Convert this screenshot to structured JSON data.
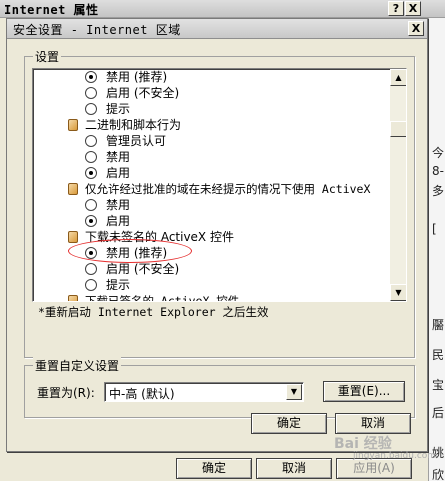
{
  "outer_window": {
    "title": "Internet 属性",
    "help_button": "?",
    "close_button": "X",
    "buttons": {
      "ok": "确定",
      "cancel": "取消",
      "apply": "应用(A)"
    },
    "background_fragments": [
      "今",
      "8-",
      "多",
      "[",
      "靨",
      "民",
      "宝",
      "后",
      "姚",
      "欣"
    ]
  },
  "dialog": {
    "title": "安全设置 - Internet 区域",
    "close_button": "X",
    "settings_group_label": "设置",
    "settings_items": [
      {
        "kind": "option",
        "label": "禁用 (推荐)",
        "checked": true
      },
      {
        "kind": "option",
        "label": "启用 (不安全)",
        "checked": false
      },
      {
        "kind": "option",
        "label": "提示",
        "checked": false
      },
      {
        "kind": "category",
        "label": "二进制和脚本行为"
      },
      {
        "kind": "option",
        "label": "管理员认可",
        "checked": false
      },
      {
        "kind": "option",
        "label": "禁用",
        "checked": false
      },
      {
        "kind": "option",
        "label": "启用",
        "checked": true
      },
      {
        "kind": "category",
        "label": "仅允许经过批准的域在未经提示的情况下使用 ActiveX"
      },
      {
        "kind": "option",
        "label": "禁用",
        "checked": false
      },
      {
        "kind": "option",
        "label": "启用",
        "checked": true
      },
      {
        "kind": "category",
        "label": "下载未签名的 ActiveX 控件"
      },
      {
        "kind": "option",
        "label": "禁用 (推荐)",
        "checked": true
      },
      {
        "kind": "option",
        "label": "启用 (不安全)",
        "checked": false
      },
      {
        "kind": "option",
        "label": "提示",
        "checked": false
      },
      {
        "kind": "category",
        "label": "下载已签名的 ActiveX 控件"
      }
    ],
    "restart_note": "*重新启动 Internet Explorer 之后生效",
    "reset_group_label": "重置自定义设置",
    "reset_to_label": "重置为(R):",
    "reset_level": "中-高 (默认)",
    "reset_button": "重置(E)...",
    "ok_button": "确定",
    "cancel_button": "取消"
  },
  "watermark": {
    "brand": "Bai 经验",
    "url": "jingyan.baidu.com"
  },
  "colors": {
    "annotation": "#e53030",
    "dialog_bg": "#ece9d8"
  }
}
